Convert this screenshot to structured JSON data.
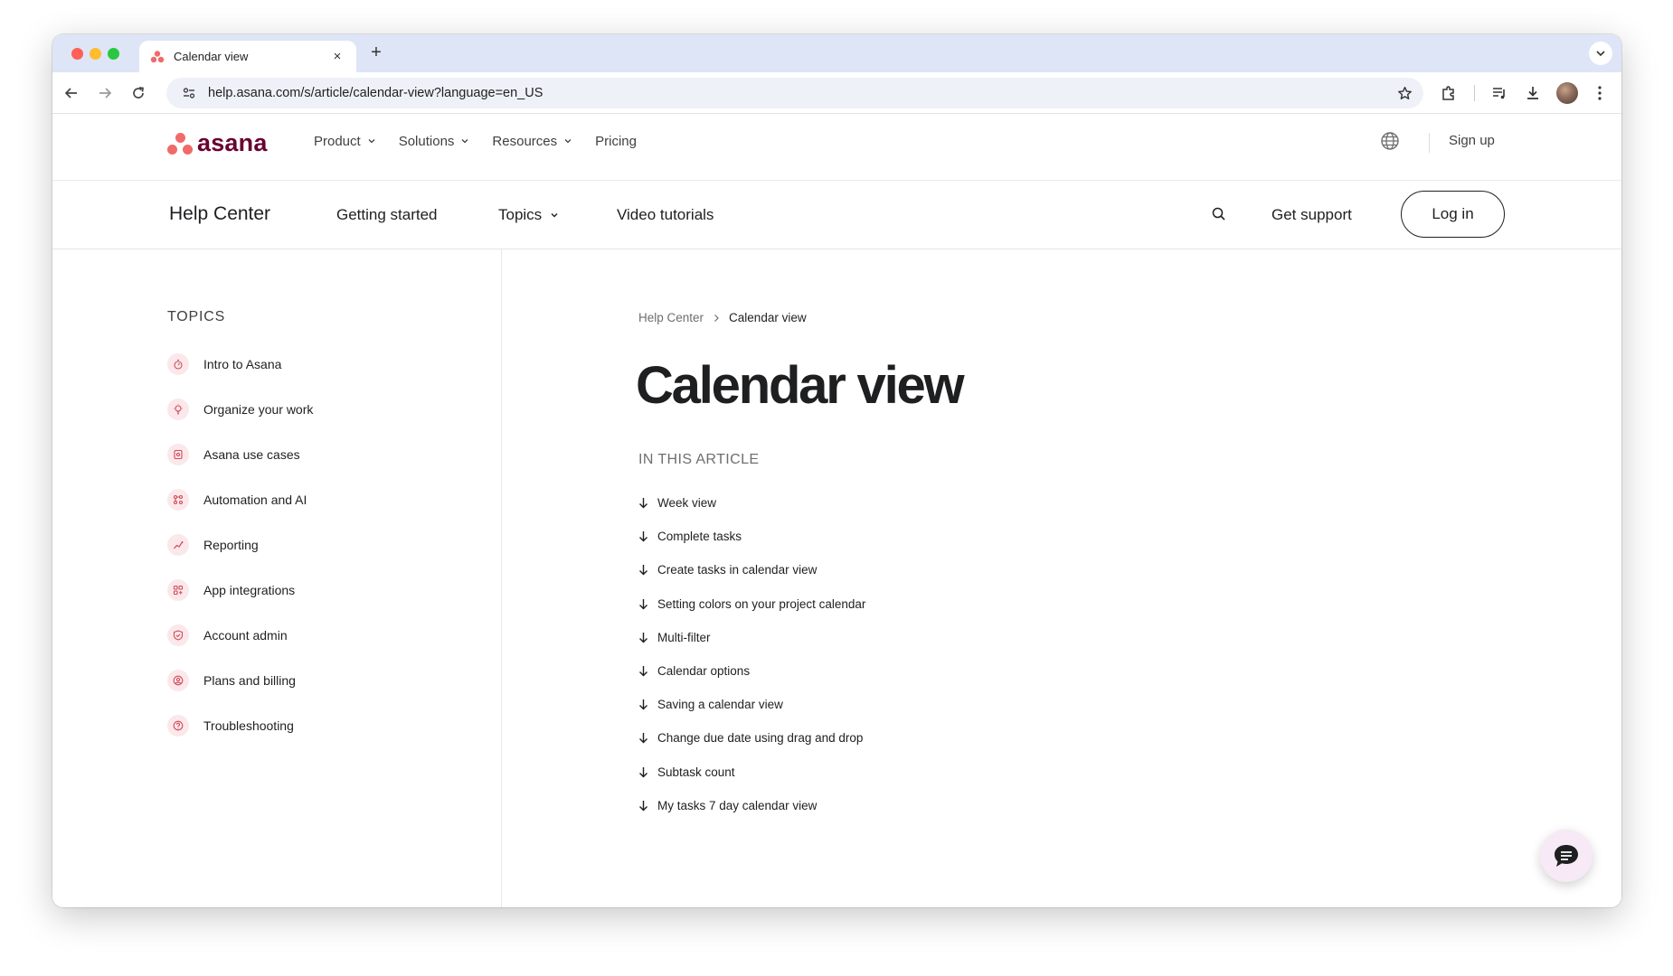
{
  "browser": {
    "tab_title": "Calendar view",
    "new_tab_symbol": "+",
    "close_symbol": "×",
    "url": "help.asana.com/s/article/calendar-view?language=en_US"
  },
  "site_nav": {
    "logo_text": "asana",
    "menu": [
      {
        "label": "Product",
        "has_dropdown": true
      },
      {
        "label": "Solutions",
        "has_dropdown": true
      },
      {
        "label": "Resources",
        "has_dropdown": true
      },
      {
        "label": "Pricing",
        "has_dropdown": false
      }
    ],
    "signup": "Sign up"
  },
  "help_nav": {
    "title": "Help Center",
    "getting_started": "Getting started",
    "topics": "Topics",
    "video_tutorials": "Video tutorials",
    "get_support": "Get support",
    "login": "Log in"
  },
  "sidebar": {
    "heading": "TOPICS",
    "items": [
      {
        "label": "Intro to Asana",
        "icon": "stopwatch-icon"
      },
      {
        "label": "Organize your work",
        "icon": "lightbulb-icon"
      },
      {
        "label": "Asana use cases",
        "icon": "gear-icon"
      },
      {
        "label": "Automation and AI",
        "icon": "workflow-icon"
      },
      {
        "label": "Reporting",
        "icon": "chart-icon"
      },
      {
        "label": "App integrations",
        "icon": "apps-icon"
      },
      {
        "label": "Account admin",
        "icon": "shield-icon"
      },
      {
        "label": "Plans and billing",
        "icon": "person-circle-icon"
      },
      {
        "label": "Troubleshooting",
        "icon": "question-icon"
      }
    ]
  },
  "article": {
    "breadcrumb": {
      "parent": "Help Center",
      "current": "Calendar view"
    },
    "title": "Calendar view",
    "toc_heading": "IN THIS ARTICLE",
    "toc": [
      "Week view",
      "Complete tasks",
      "Create tasks in calendar view",
      "Setting colors on your project calendar",
      "Multi-filter",
      "Calendar options",
      "Saving a calendar view",
      "Change due date using drag and drop",
      "Subtask count",
      "My tasks 7 day calendar view"
    ]
  },
  "colors": {
    "brand_coral": "#f06a6a",
    "brand_plum": "#690031",
    "tab_strip": "#dde5f7",
    "icon_bg": "#fbe8ea",
    "chat_bg": "#f7e9f6"
  }
}
